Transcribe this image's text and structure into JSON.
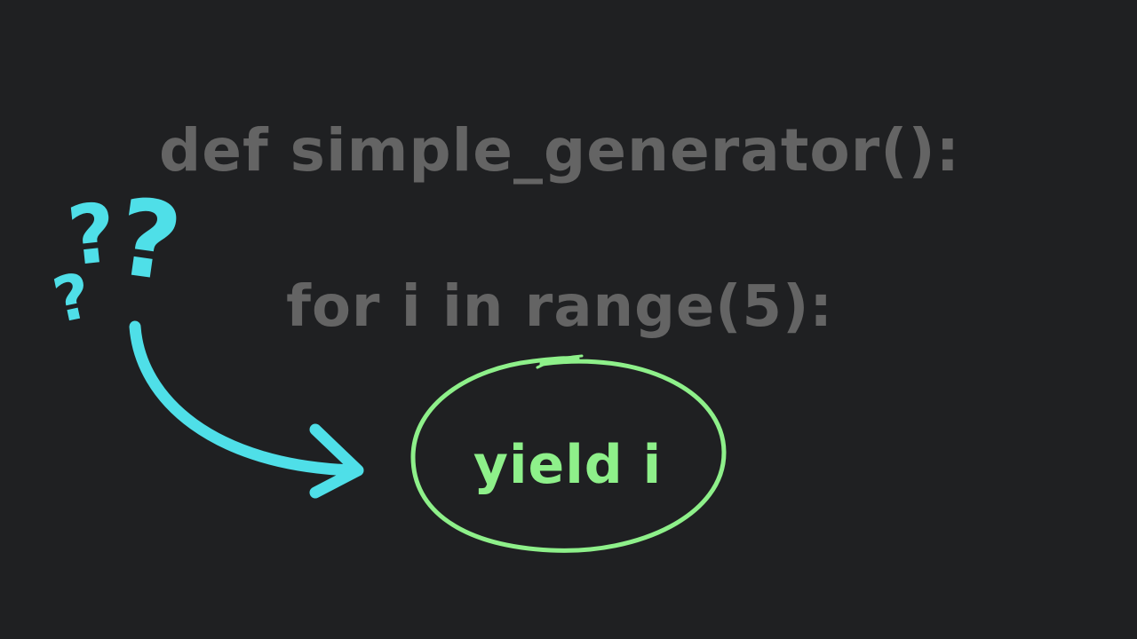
{
  "code": {
    "line1": "def simple_generator():",
    "line2": "for i in range(5):",
    "line3": "yield i"
  },
  "annotations": {
    "question_marks": [
      "?",
      "?",
      "?"
    ],
    "arrow_icon": "curved-arrow-icon",
    "circle_icon": "hand-drawn-circle-icon"
  },
  "colors": {
    "background": "#1f2022",
    "code_text": "#646464",
    "highlight_text": "#8ef08a",
    "circle_stroke": "#8ef08a",
    "accent": "#4fdfe8"
  }
}
